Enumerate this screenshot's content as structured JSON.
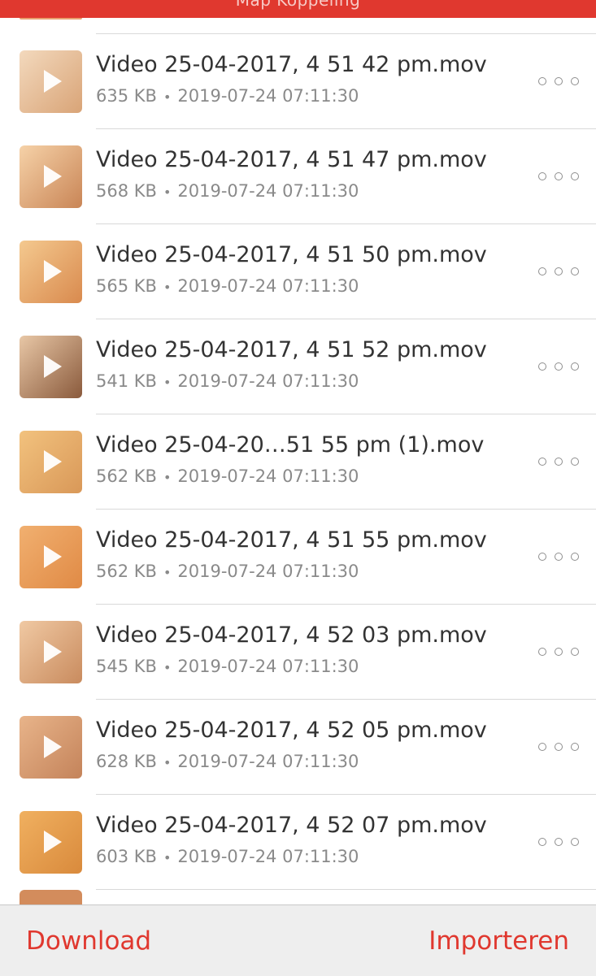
{
  "header": {
    "title": "Map Koppeling",
    "color": "#e0382f"
  },
  "files": [
    {
      "name": "Video 25-04-2017, 4 51 42 pm.mov",
      "size": "635 KB",
      "date": "2019-07-24 07:11:30",
      "thumb_colors": [
        "#f3d9bd",
        "#d9a477"
      ]
    },
    {
      "name": "Video 25-04-2017, 4 51 47 pm.mov",
      "size": "568 KB",
      "date": "2019-07-24 07:11:30",
      "thumb_colors": [
        "#f6d2a8",
        "#c98556"
      ]
    },
    {
      "name": "Video 25-04-2017, 4 51 50 pm.mov",
      "size": "565 KB",
      "date": "2019-07-24 07:11:30",
      "thumb_colors": [
        "#f4c98f",
        "#d98a4e"
      ]
    },
    {
      "name": "Video 25-04-2017, 4 51 52 pm.mov",
      "size": "541 KB",
      "date": "2019-07-24 07:11:30",
      "thumb_colors": [
        "#e8c7a6",
        "#8a5a3c"
      ]
    },
    {
      "name": "Video 25-04-20…51 55 pm (1).mov",
      "size": "562 KB",
      "date": "2019-07-24 07:11:30",
      "thumb_colors": [
        "#f2c27e",
        "#d99858"
      ]
    },
    {
      "name": "Video 25-04-2017, 4 51 55 pm.mov",
      "size": "562 KB",
      "date": "2019-07-24 07:11:30",
      "thumb_colors": [
        "#f1b070",
        "#e08a45"
      ]
    },
    {
      "name": "Video 25-04-2017, 4 52 03 pm.mov",
      "size": "545 KB",
      "date": "2019-07-24 07:11:30",
      "thumb_colors": [
        "#f0c9a3",
        "#c98b5e"
      ]
    },
    {
      "name": "Video 25-04-2017, 4 52 05 pm.mov",
      "size": "628 KB",
      "date": "2019-07-24 07:11:30",
      "thumb_colors": [
        "#e8b48a",
        "#c4835a"
      ]
    },
    {
      "name": "Video 25-04-2017, 4 52 07 pm.mov",
      "size": "603 KB",
      "date": "2019-07-24 07:11:30",
      "thumb_colors": [
        "#f0b060",
        "#d98a3c"
      ]
    }
  ],
  "separator": "•",
  "icons": {
    "play": "play-icon",
    "more": "more-icon"
  },
  "toolbar": {
    "download_label": "Download",
    "import_label": "Importeren",
    "accent_color": "#e0382f"
  }
}
